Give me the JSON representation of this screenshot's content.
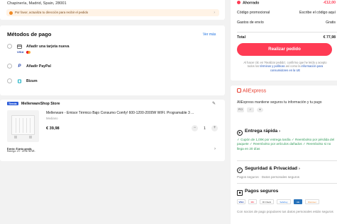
{
  "address": {
    "line": "Chapinería, Madrid, Spain, 28001",
    "warning": "Por favor, actualiza tu dirección para recibir el pedido"
  },
  "payment": {
    "title": "Métodos de pago",
    "see_more": "Ver más",
    "methods": [
      {
        "label": "Añadir una tarjeta nueva",
        "icon": "credit-card-icon",
        "sub": "VISA"
      },
      {
        "label": "Añadir PayPal",
        "icon": "paypal-icon"
      },
      {
        "label": "Bizum",
        "icon": "bizum-icon"
      }
    ]
  },
  "store": {
    "badge": "Tienda",
    "name": "MellerwareShop Store",
    "product": "Mellerware - Emisor Térmico Bajo Consumo Comfy! 600-1200-2000W WIFI. Programable 3 ...",
    "color": "Mediano",
    "price": "€ 39,98",
    "quantity": "1",
    "shipping": "Envío: Envío gratis",
    "delivery": "Entrega: 23 - 24 de MAR."
  },
  "summary": {
    "savings_label": "Ahorrado",
    "savings_value": "-€12,00",
    "promo_label": "Código promocional",
    "promo_value": "Escribe el código aquí",
    "shipping_label": "Gastos de envío",
    "shipping_value": "Gratis",
    "total_label": "Total",
    "total_value": "€ 77,98",
    "place_order": "Realizar pedido",
    "legal_1": "Al hacer clic en 'Realizar pedido', confirmo que he leído y acepto todos los",
    "legal_link_1": "términos y políticas",
    "legal_2": "así como la",
    "legal_link_2": "información para consumidores en la UE"
  },
  "secure": {
    "brand": "AliExpress",
    "tagline": "AliExpress mantiene seguros tu información y tu pago",
    "delivery_title": "Entrega rápida",
    "delivery_items": "✓ Cupón de 1,00€ por entrega tardía  ✓ Reembolso por pérdida del paquete  ✓ Reembolso por artículos dañados  ✓ Reembolso si no llega en 20 días",
    "privacy_title": "Seguridad & Privacidad",
    "privacy_text": "Pagos seguros · Datos personales seguros",
    "payments_title": "Pagos seguros",
    "payments_text": "Con socios de pago populares tus datos personales están seguros",
    "card_brands": [
      "VISA",
      "MC",
      "ID Check",
      "SafeKey",
      "AE",
      "Discover"
    ]
  },
  "colors": {
    "accent": "#ff3b54",
    "brand": "#e53a2b",
    "link": "#1a6fe0",
    "success": "#2f9a58"
  }
}
